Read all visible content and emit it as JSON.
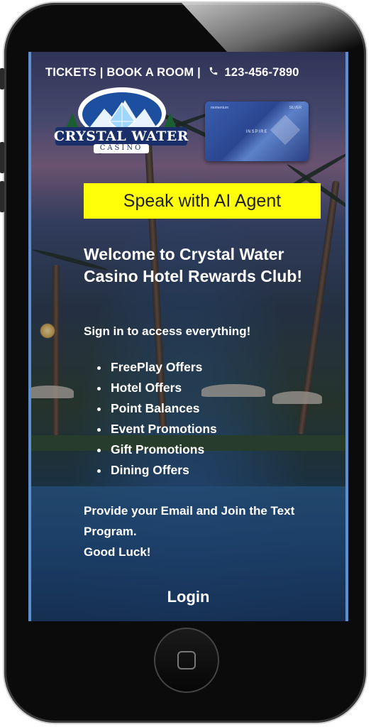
{
  "top_nav": {
    "tickets": "TICKETS",
    "sep1": "|",
    "book_room": "BOOK A ROOM",
    "sep2": "|",
    "phone": "123-456-7890"
  },
  "logo": {
    "name": "CRYSTAL WATER",
    "sub": "CASINO"
  },
  "rewards_card": {
    "brand": "momentum",
    "code": "SILVER",
    "name": "INSPIRE"
  },
  "ai_button": "Speak with AI Agent",
  "welcome_heading": "Welcome to Crystal Water Casino Hotel Rewards Club!",
  "signin_text": "Sign in to access everything!",
  "benefits": [
    "FreePlay Offers",
    "Hotel Offers",
    "Point Balances",
    "Event Promotions",
    "Gift Promotions",
    "Dining Offers"
  ],
  "provide_text_line1": "Provide your Email and Join the Text Program.",
  "provide_text_line2": "Good Luck!",
  "login_label": "Login",
  "colors": {
    "ai_button_bg": "#ffff0a",
    "screen_border": "#5b8fd0",
    "text": "#ffffff"
  }
}
